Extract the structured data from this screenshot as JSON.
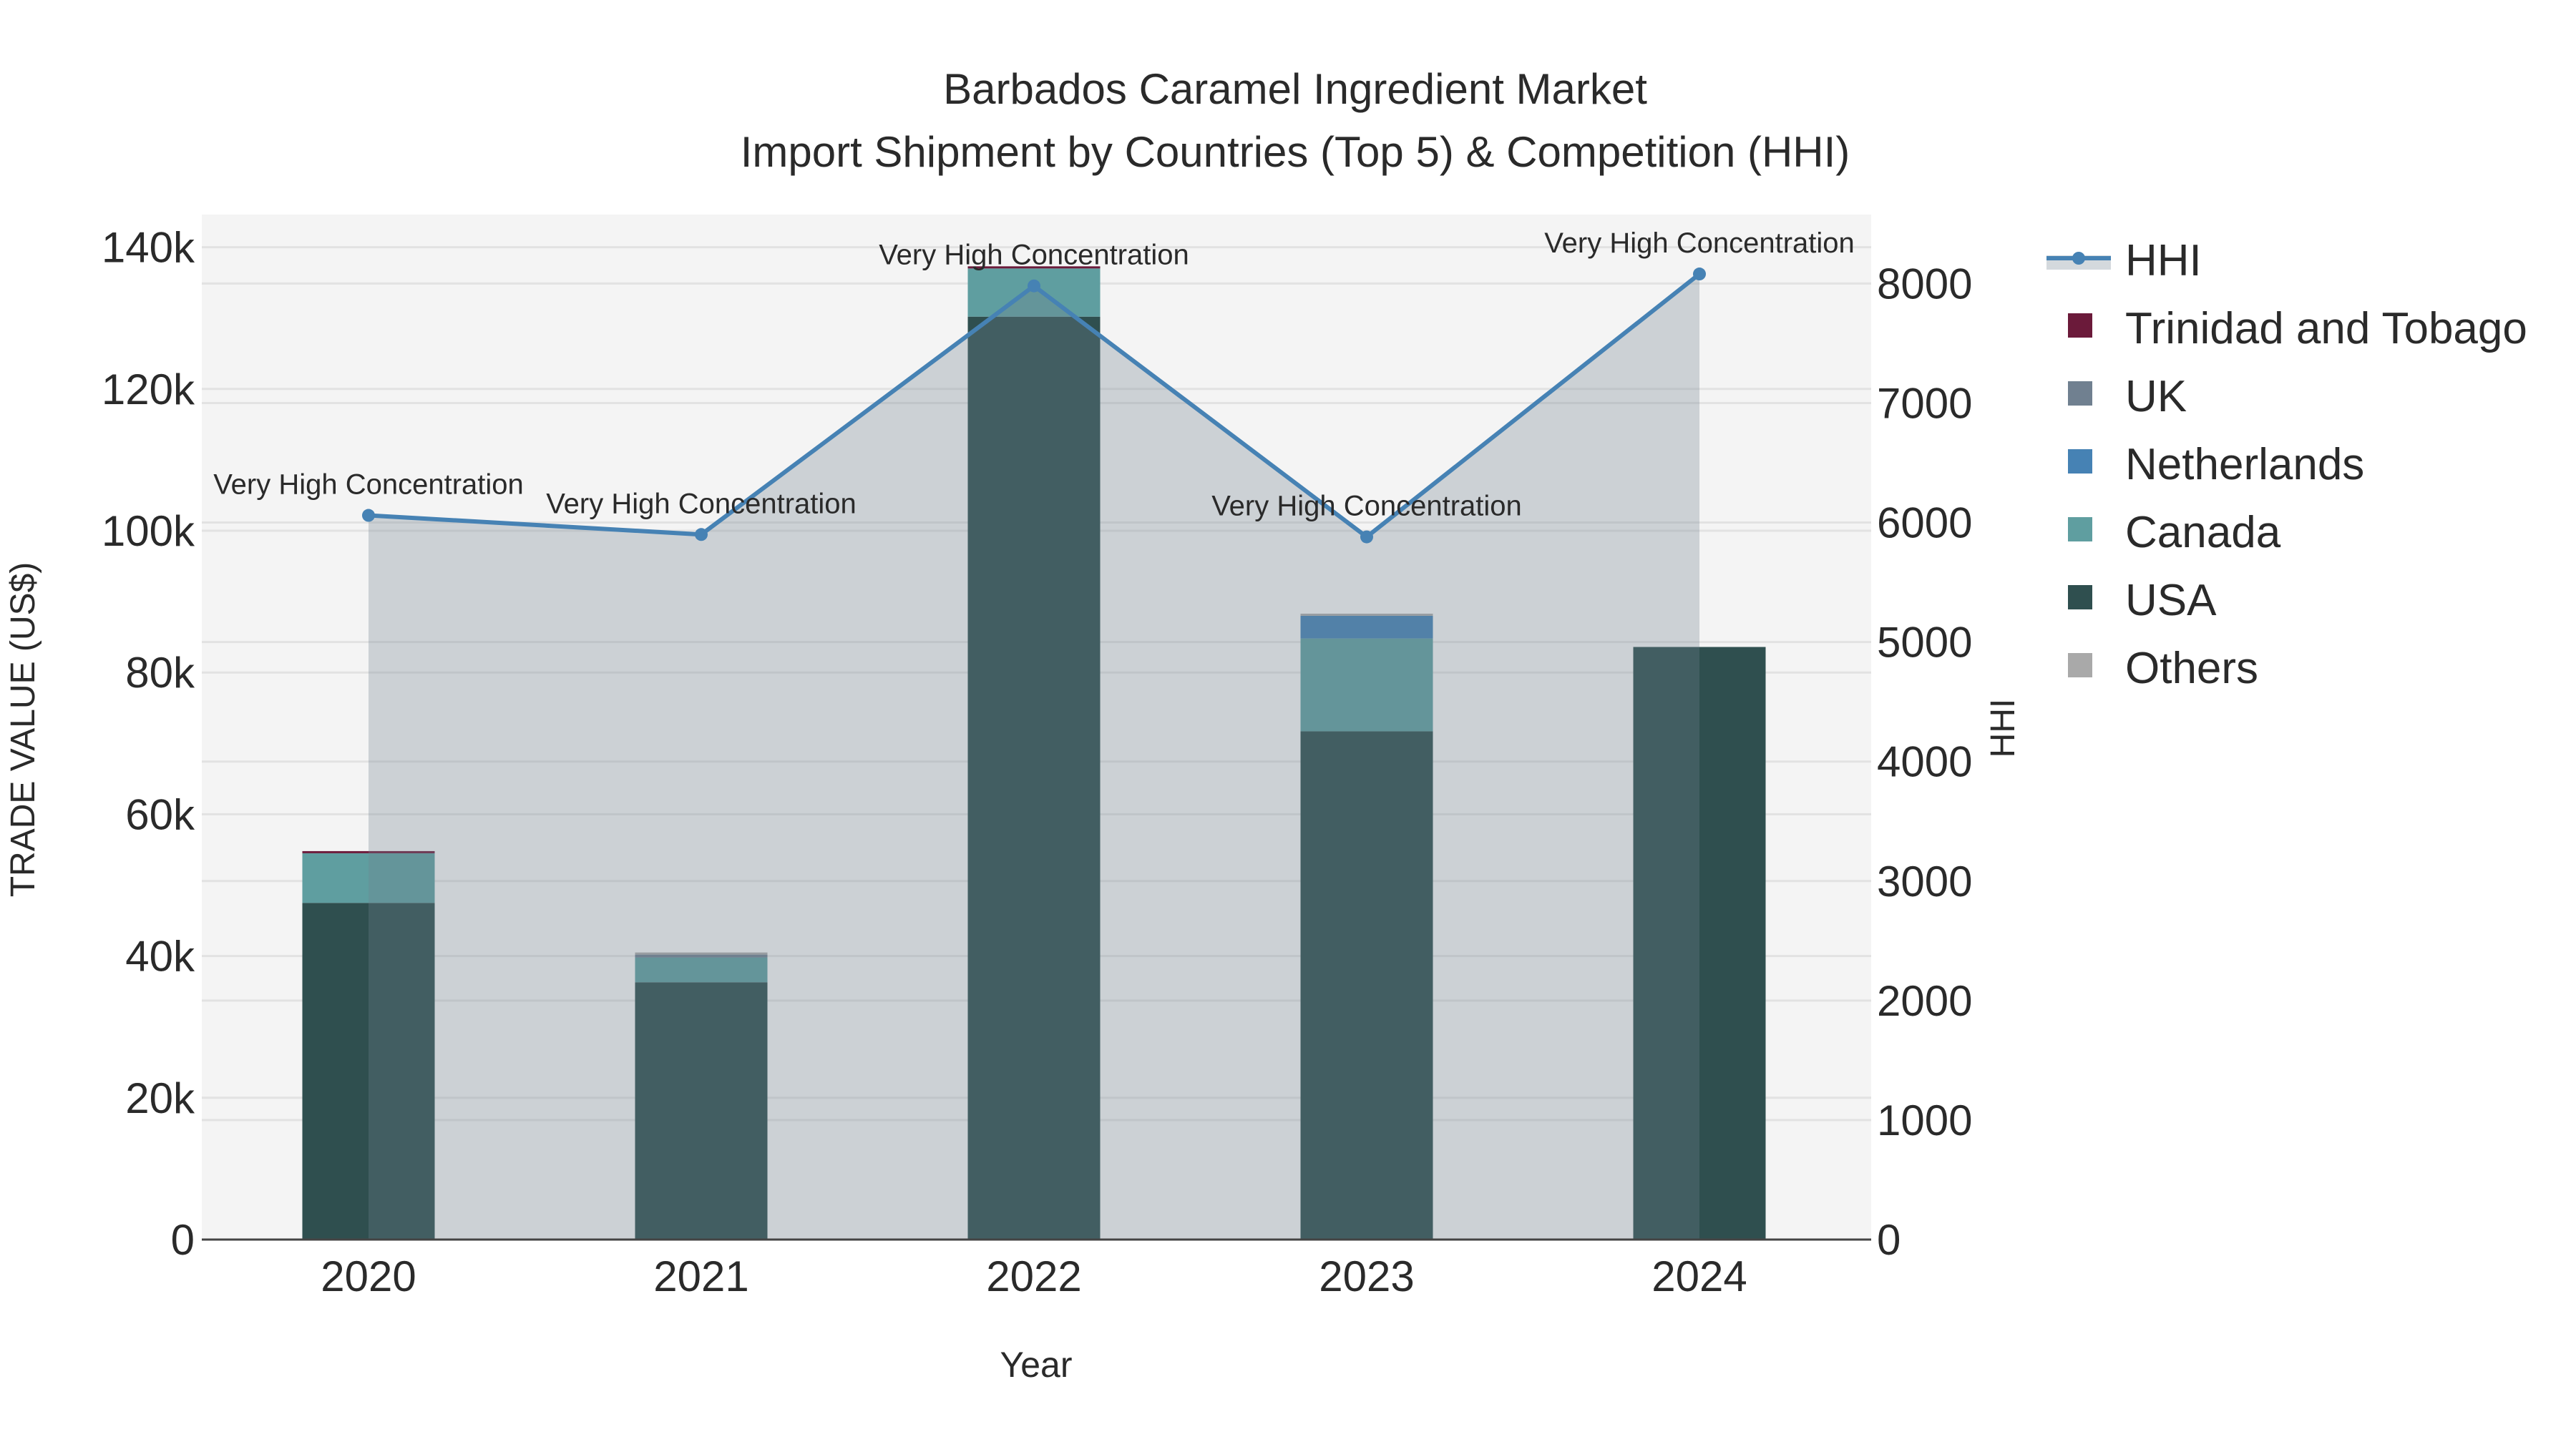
{
  "chart_data": {
    "type": "bar",
    "title_line1": "Barbados Caramel Ingredient Market",
    "title_line2": "Import Shipment by Countries (Top 5) & Competition (HHI)",
    "xlabel": "Year",
    "ylabel": "TRADE VALUE (US$)",
    "y2label": "HHI",
    "categories": [
      "2020",
      "2021",
      "2022",
      "2023",
      "2024"
    ],
    "ylim": [
      0,
      144600
    ],
    "y2lim": [
      0,
      8577
    ],
    "yticks": [
      0,
      20000,
      40000,
      60000,
      80000,
      100000,
      120000,
      140000
    ],
    "ytick_labels": [
      "0",
      "20k",
      "40k",
      "60k",
      "80k",
      "100k",
      "120k",
      "140k"
    ],
    "y2ticks": [
      0,
      1000,
      2000,
      3000,
      4000,
      5000,
      6000,
      7000,
      8000
    ],
    "y2tick_labels": [
      "0",
      "1000",
      "2000",
      "3000",
      "4000",
      "5000",
      "6000",
      "7000",
      "8000"
    ],
    "grid": true,
    "legend_position": "right",
    "series": [
      {
        "name": "USA",
        "color": "#2f4f4f",
        "values": [
          47500,
          36300,
          130200,
          71700,
          83600
        ]
      },
      {
        "name": "Canada",
        "color": "#5f9ea0",
        "values": [
          7000,
          3500,
          6800,
          13100,
          0
        ]
      },
      {
        "name": "Netherlands",
        "color": "#4682b4",
        "values": [
          0,
          0,
          0,
          3200,
          0
        ]
      },
      {
        "name": "UK",
        "color": "#708090",
        "values": [
          0,
          400,
          0,
          0,
          0
        ]
      },
      {
        "name": "Trinidad and Tobago",
        "color": "#6b1a3a",
        "values": [
          300,
          0,
          300,
          0,
          0
        ]
      },
      {
        "name": "Others",
        "color": "#a9a9a9",
        "values": [
          0,
          300,
          0,
          300,
          0
        ]
      }
    ],
    "hhi": {
      "name": "HHI",
      "color": "#4682b4",
      "values": [
        6060,
        5900,
        7980,
        5880,
        8080
      ],
      "annotations": [
        "Very High Concentration",
        "Very High Concentration",
        "Very High Concentration",
        "Very High Concentration",
        "Very High Concentration"
      ]
    },
    "legend": [
      "HHI",
      "Trinidad and Tobago",
      "UK",
      "Netherlands",
      "Canada",
      "USA",
      "Others"
    ]
  }
}
